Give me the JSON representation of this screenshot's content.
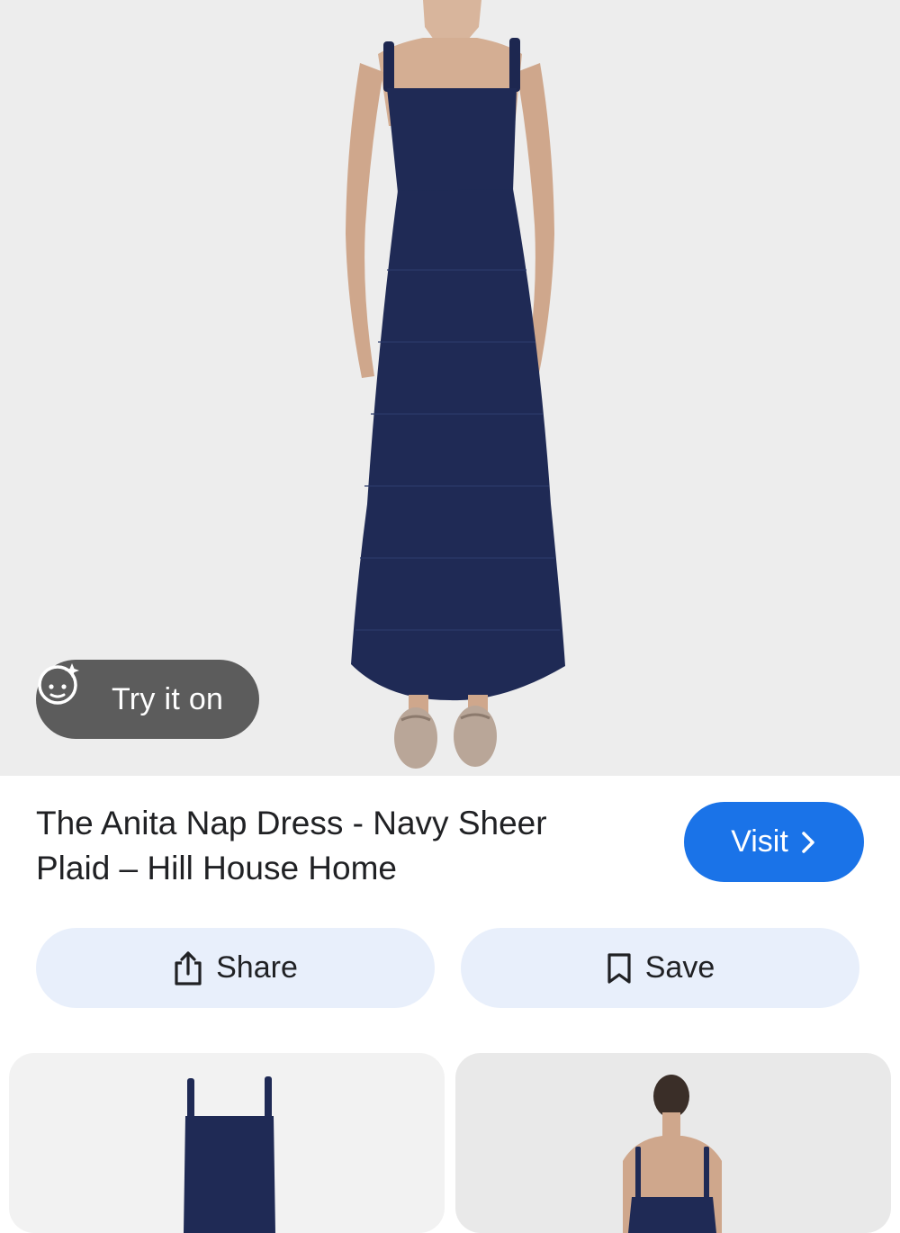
{
  "hero": {
    "try_on_label": "Try it on",
    "try_on_icon": "face-sparkle-icon"
  },
  "product": {
    "title": "The Anita Nap Dress - Navy Sheer Plaid – Hill House Home"
  },
  "actions": {
    "visit_label": "Visit",
    "share_label": "Share",
    "save_label": "Save"
  },
  "colors": {
    "accent": "#1a73e8",
    "action_bg": "#e8effb",
    "dress": "#1f2a55"
  }
}
